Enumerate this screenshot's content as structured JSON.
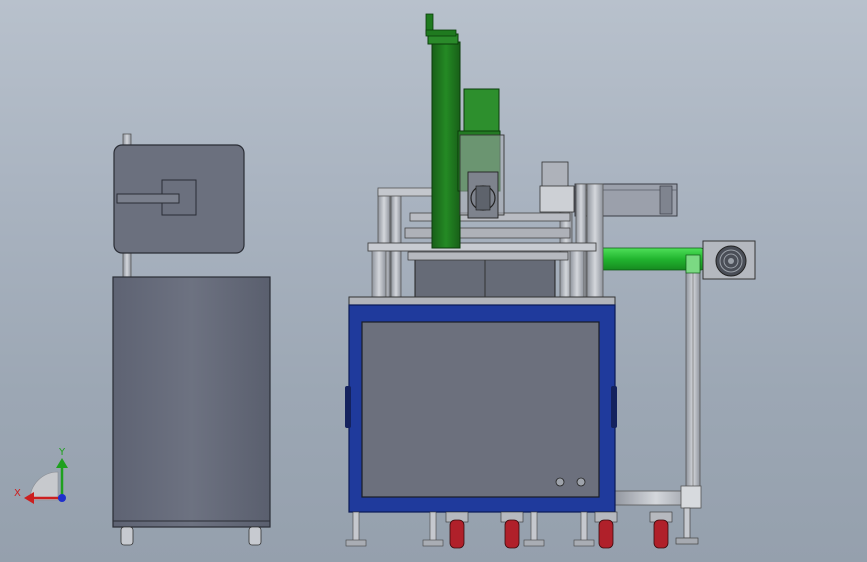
{
  "app": {
    "view": "cad-3d-viewport",
    "background_top": "#b8c1cc",
    "background_bottom": "#95a0ad"
  },
  "colors": {
    "frame_blue": "#1f3a9c",
    "panel_gray": "#6a6f7d",
    "green_part": "#1f7a1f",
    "bright_green": "#2bc23b",
    "caster_red": "#b0202a",
    "metal": "#c9ccd2"
  },
  "triad": {
    "x_label": "X",
    "y_label": "Y",
    "x_color": "#cc1f1f",
    "y_color": "#1fa01f",
    "z_color": "#1f2fcc"
  },
  "icons": [
    "triad-icon",
    "fan-icon",
    "caster-icon"
  ]
}
